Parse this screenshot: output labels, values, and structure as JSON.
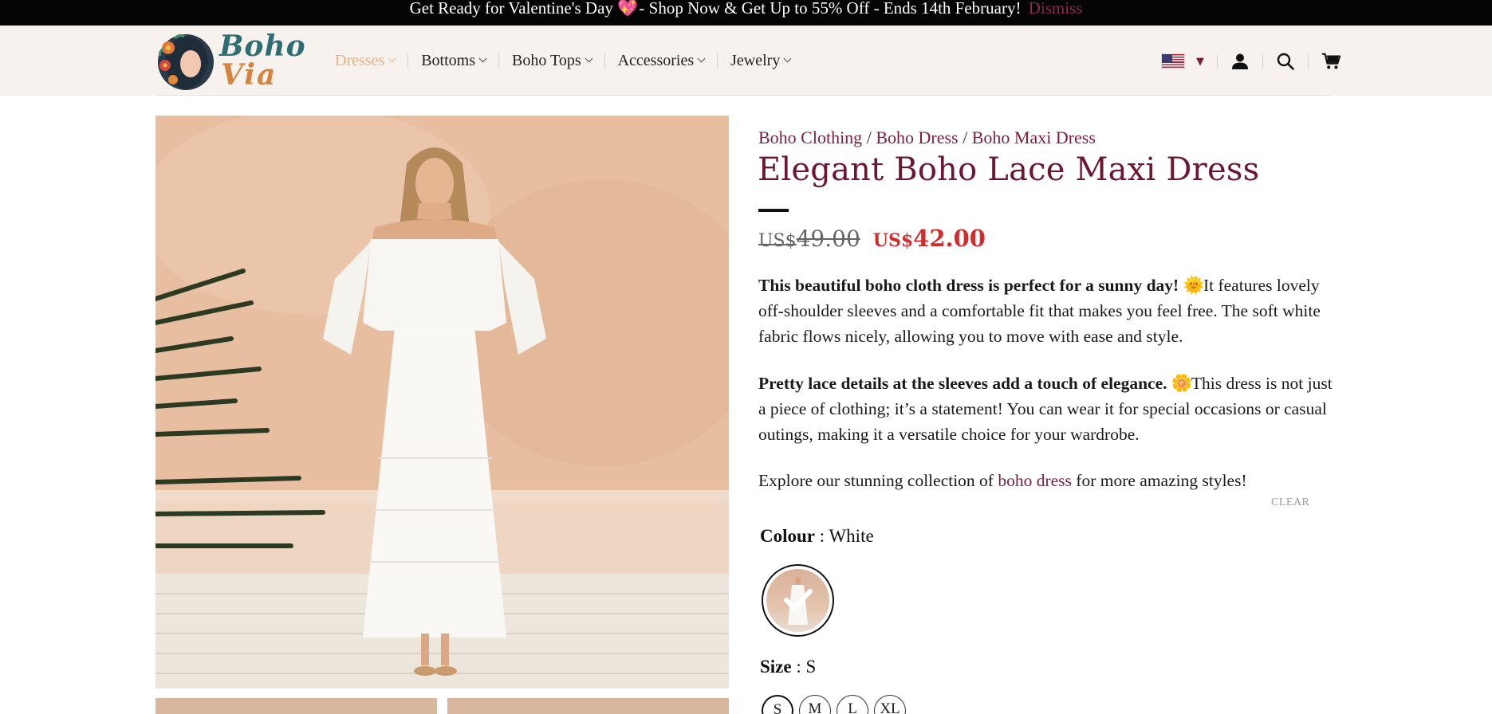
{
  "announcement": {
    "text_before": "Get Ready for Valentine's Day",
    "heart": "💖",
    "text_after": " - Shop Now & Get Up to 55% Off - Ends 14th February!",
    "dismiss": "Dismiss"
  },
  "header": {
    "logo_line1": "Boho",
    "logo_line2": "Via",
    "nav": [
      {
        "label": "Dresses"
      },
      {
        "label": "Bottoms"
      },
      {
        "label": "Boho Tops"
      },
      {
        "label": "Accessories"
      },
      {
        "label": "Jewelry"
      }
    ],
    "currency_caret": "▼"
  },
  "breadcrumb": {
    "items": [
      "Boho Clothing",
      "Boho Dress",
      "Boho Maxi Dress"
    ],
    "separator": "/"
  },
  "product": {
    "title": "Elegant Boho Lace Maxi Dress",
    "old_currency": "US$",
    "old_price": "49.00",
    "new_currency": "US$",
    "new_price": "42.00",
    "desc1_bold": "This beautiful boho cloth dress is perfect for a sunny day!",
    "desc1_emoji": "🌞",
    "desc1_rest": " It features lovely off-shoulder sleeves and a comfortable fit that makes you feel free. The soft white fabric flows nicely, allowing you to move with ease and style.",
    "desc2_bold": "Pretty lace details at the sleeves add a touch of elegance.",
    "desc2_emoji": "🌼",
    "desc2_rest": " This dress is not just a piece of clothing; it’s a statement! You can wear it for special occasions or casual outings, making it a versatile choice for your wardrobe.",
    "desc3_before": "Explore our stunning collection of ",
    "desc3_link": "boho dress",
    "desc3_after": " for more amazing styles!",
    "clear": "CLEAR",
    "colour_label": "Colour",
    "colour_value": " : White",
    "size_label": "Size",
    "size_value": " : S",
    "sizes": [
      "S",
      "M",
      "L",
      "XL"
    ]
  },
  "colors": {
    "accent": "#7a1f3a",
    "title": "#6b1633",
    "sale": "#d12d2d",
    "nav_active": "#e3b07f",
    "header_bg": "#f7f2ee"
  }
}
